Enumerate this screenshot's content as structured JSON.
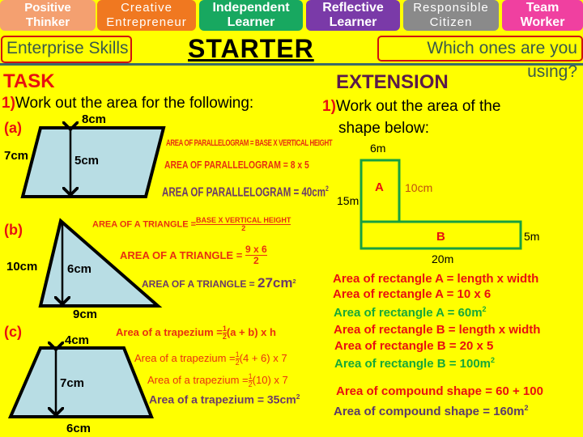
{
  "skills": [
    {
      "line1": "Positive",
      "line2": "Thinker",
      "color": "#f4a070"
    },
    {
      "line1": "Creative",
      "line2": "Entrepreneur",
      "color": "#f07820"
    },
    {
      "line1": "Independent",
      "line2": "Learner",
      "color": "#18a860"
    },
    {
      "line1": "Reflective",
      "line2": "Learner",
      "color": "#7a3aa8"
    },
    {
      "line1": "Responsible",
      "line2": "Citizen",
      "color": "#8a8a8a"
    },
    {
      "line1": "Team",
      "line2": "Worker",
      "color": "#f040a0"
    }
  ],
  "header": {
    "enterprise": "Enterprise Skills",
    "title": "STARTER",
    "question": "Which ones are you using?"
  },
  "task": {
    "heading": "TASK",
    "num": "1)",
    "instruction": "Work out the area for the following:",
    "a": {
      "label": "(a)",
      "top": "8cm",
      "side": "7cm",
      "height": "5cm",
      "f1": "AREA OF PARALLELOGRAM = BASE X VERTICAL HEIGHT",
      "f2": "AREA OF PARALLELOGRAM = 8  x  5",
      "f3": "AREA OF PARALLELOGRAM = 40cm",
      "sq": "2"
    },
    "b": {
      "label": "(b)",
      "side": "10cm",
      "height": "6cm",
      "base": "9cm",
      "f1": "AREA OF A TRIANGLE =",
      "f1n": "BASE X VERTICAL HEIGHT",
      "f1d": "2",
      "f2": "AREA OF A TRIANGLE =",
      "f2n": "9  x  6",
      "f2d": "2",
      "f3": "AREA OF A TRIANGLE =",
      "f3v": "27cm",
      "sq": "2"
    },
    "c": {
      "label": "(c)",
      "top": "4cm",
      "height": "7cm",
      "base": "6cm",
      "f1": "Area of a trapezium =",
      "f1r": "(a + b) x h",
      "f2": "Area of a trapezium =",
      "f2r": "(4 + 6) x 7",
      "f3": "Area of a trapezium =",
      "f3r": "(10) x 7",
      "f4": "Area of a trapezium = 35cm",
      "half_n": "1",
      "half_d": "2",
      "sq": "2"
    }
  },
  "extension": {
    "heading": "EXTENSION",
    "num": "1)",
    "instruction1": "Work out the area of the",
    "instruction2": "shape below:",
    "shape": {
      "top": "6m",
      "left": "15m",
      "a_label": "A",
      "a_side": "10cm",
      "b_label": "B",
      "b_side": "5m",
      "bottom": "20m"
    },
    "lines": [
      {
        "text": "Area of rectangle A = length x width",
        "sq": ""
      },
      {
        "text": "Area of rectangle A = 10 x 6",
        "sq": ""
      },
      {
        "text": "Area of rectangle A = 60m",
        "sq": "2"
      },
      {
        "text": "Area of rectangle B = length x width",
        "sq": ""
      },
      {
        "text": "Area of rectangle B = 20 x 5",
        "sq": ""
      },
      {
        "text": "Area of rectangle B = 100m",
        "sq": "2"
      },
      {
        "text": "Area of compound shape = 60 + 100",
        "sq": ""
      },
      {
        "text": "Area of compound shape = 160m",
        "sq": "2"
      }
    ]
  }
}
